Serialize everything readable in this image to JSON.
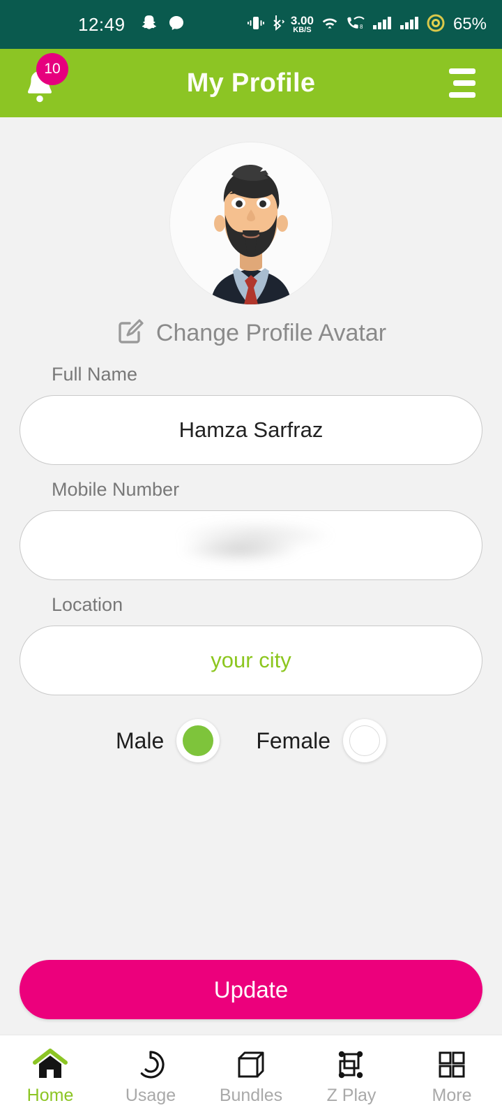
{
  "status_bar": {
    "time": "12:49",
    "left_icons": [
      "snapchat-icon",
      "messenger-icon"
    ],
    "data_rate_value": "3.00",
    "data_rate_unit": "KB/S",
    "right_icons": [
      "vibrate-icon",
      "bluetooth-icon",
      "wifi-icon",
      "call-wifi-icon",
      "signal-bars-sim1-icon",
      "signal-bars-sim2-icon",
      "battery-icon"
    ],
    "battery": "65%",
    "background_color": "#0a5a4e"
  },
  "app_bar": {
    "title": "My Profile",
    "notification_badge_count": "10",
    "bell_icon": "bell-icon",
    "menu_icon": "hamburger-menu-icon",
    "background_color": "#8cc524",
    "badge_color": "#e6007e"
  },
  "profile": {
    "avatar_icon": "user-avatar-illustration",
    "change_avatar_label": "Change Profile Avatar",
    "change_avatar_icon": "edit-pencil-square-icon"
  },
  "form": {
    "fields": [
      {
        "label": "Full Name",
        "value": "Hamza Sarfraz",
        "placeholder": "",
        "state": "filled"
      },
      {
        "label": "Mobile Number",
        "value": "",
        "placeholder": "",
        "state": "blurred"
      },
      {
        "label": "Location",
        "value": "",
        "placeholder": "your city",
        "state": "placeholder"
      }
    ],
    "gender": {
      "options": [
        {
          "label": "Male",
          "selected": true
        },
        {
          "label": "Female",
          "selected": false
        }
      ],
      "selected_color": "#7ec43b"
    },
    "submit_label": "Update",
    "submit_color": "#ec007c"
  },
  "bottom_nav": {
    "active_color": "#8cc524",
    "inactive_color": "#a9a9a9",
    "items": [
      {
        "label": "Home",
        "icon": "home-icon",
        "active": true
      },
      {
        "label": "Usage",
        "icon": "usage-donut-icon",
        "active": false
      },
      {
        "label": "Bundles",
        "icon": "cube-box-icon",
        "active": false
      },
      {
        "label": "Z Play",
        "icon": "z-play-transform-icon",
        "active": false
      },
      {
        "label": "More",
        "icon": "grid-more-icon",
        "active": false
      }
    ]
  }
}
